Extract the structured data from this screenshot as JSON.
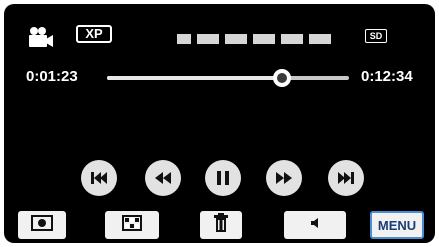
{
  "header": {
    "mode_icon": "video-camera-icon",
    "quality_badge": "XP",
    "media_badge": "SD",
    "date_placeholder_icon": "masked-date-dots"
  },
  "timeline": {
    "current_time": "0:01:23",
    "total_time": "0:12:34",
    "progress_fraction": 0.725
  },
  "controls": {
    "icons": [
      "skip-back-icon",
      "rewind-icon",
      "pause-icon",
      "fast-forward-icon",
      "skip-forward-icon"
    ]
  },
  "bottom_bar": {
    "icons": [
      "snapshot-icon",
      "index-view-icon",
      "trash-icon",
      "volume-icon"
    ],
    "menu_label": "MENU",
    "menu_accent": "#4a8fd6"
  },
  "colors": {
    "background": "#000000",
    "control_fill": "#e2e2e2",
    "button_fill": "#f1f1f1"
  }
}
